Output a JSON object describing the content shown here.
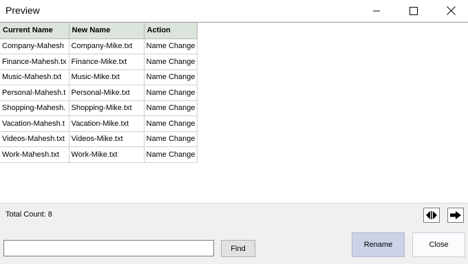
{
  "window": {
    "title": "Preview",
    "minimize_icon": "minimize-icon",
    "maximize_icon": "maximize-icon",
    "close_icon": "close-icon"
  },
  "table": {
    "columns": [
      "Current Name",
      "New Name",
      "Action"
    ],
    "rows": [
      [
        "Company-Mahesh",
        "Company-Mike.txt",
        "Name Change"
      ],
      [
        "Finance-Mahesh.tx",
        "Finance-Mike.txt",
        "Name Change"
      ],
      [
        "Music-Mahesh.txt",
        "Music-Mike.txt",
        "Name Change"
      ],
      [
        "Personal-Mahesh.t",
        "Personal-Mike.txt",
        "Name Change"
      ],
      [
        "Shopping-Mahesh.",
        "Shopping-Mike.txt",
        "Name Change"
      ],
      [
        "Vacation-Mahesh.t",
        "Vacation-Mike.txt",
        "Name Change"
      ],
      [
        "Videos-Mahesh.txt",
        "Videos-Mike.txt",
        "Name Change"
      ],
      [
        "Work-Mahesh.txt",
        "Work-Mike.txt",
        "Name Change"
      ]
    ],
    "header_color": "#dbe5dc"
  },
  "footer": {
    "total_count": "Total Count: 8",
    "swap_icon": "swap-arrows-icon",
    "next_icon": "arrow-right-icon"
  },
  "search": {
    "value": "",
    "placeholder": "",
    "find_label": "Find"
  },
  "actions": {
    "rename_label": "Rename",
    "close_label": "Close",
    "rename_color": "#cdd3e6"
  }
}
